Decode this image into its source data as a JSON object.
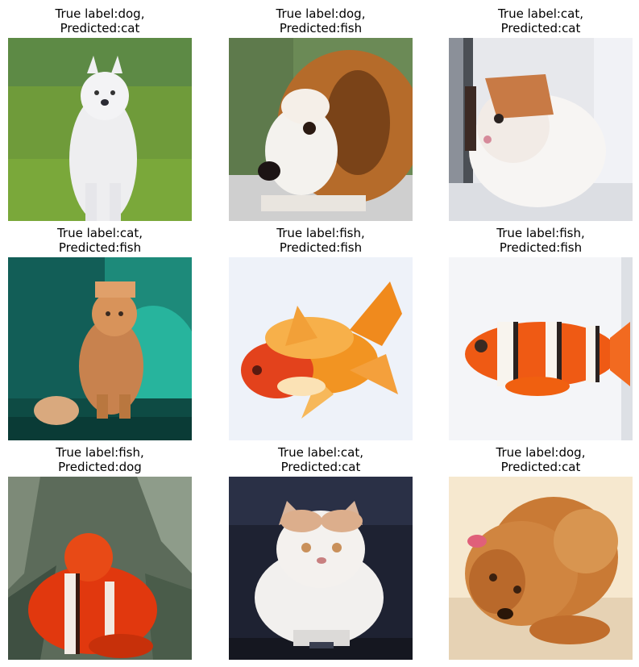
{
  "grid": {
    "cells": [
      {
        "title_line1": "True label:dog,",
        "title_line2": "Predicted:cat",
        "subject": "white-spitz-dog-on-grass"
      },
      {
        "title_line1": "True label:dog,",
        "title_line2": "Predicted:fish",
        "subject": "brown-white-puppy-closeup"
      },
      {
        "title_line1": "True label:cat,",
        "title_line2": "Predicted:cat",
        "subject": "white-orange-kitten"
      },
      {
        "title_line1": "True label:cat,",
        "title_line2": "Predicted:fish",
        "subject": "ginger-cat-teal-background"
      },
      {
        "title_line1": "True label:fish,",
        "title_line2": "Predicted:fish",
        "subject": "orange-goldfish"
      },
      {
        "title_line1": "True label:fish,",
        "title_line2": "Predicted:fish",
        "subject": "clownfish-white-background"
      },
      {
        "title_line1": "True label:fish,",
        "title_line2": "Predicted:dog",
        "subject": "clownfish-in-seaweed"
      },
      {
        "title_line1": "True label:cat,",
        "title_line2": "Predicted:cat",
        "subject": "fluffy-white-cat-dark-background"
      },
      {
        "title_line1": "True label:dog,",
        "title_line2": "Predicted:cat",
        "subject": "red-poodle-lying-down"
      }
    ]
  }
}
